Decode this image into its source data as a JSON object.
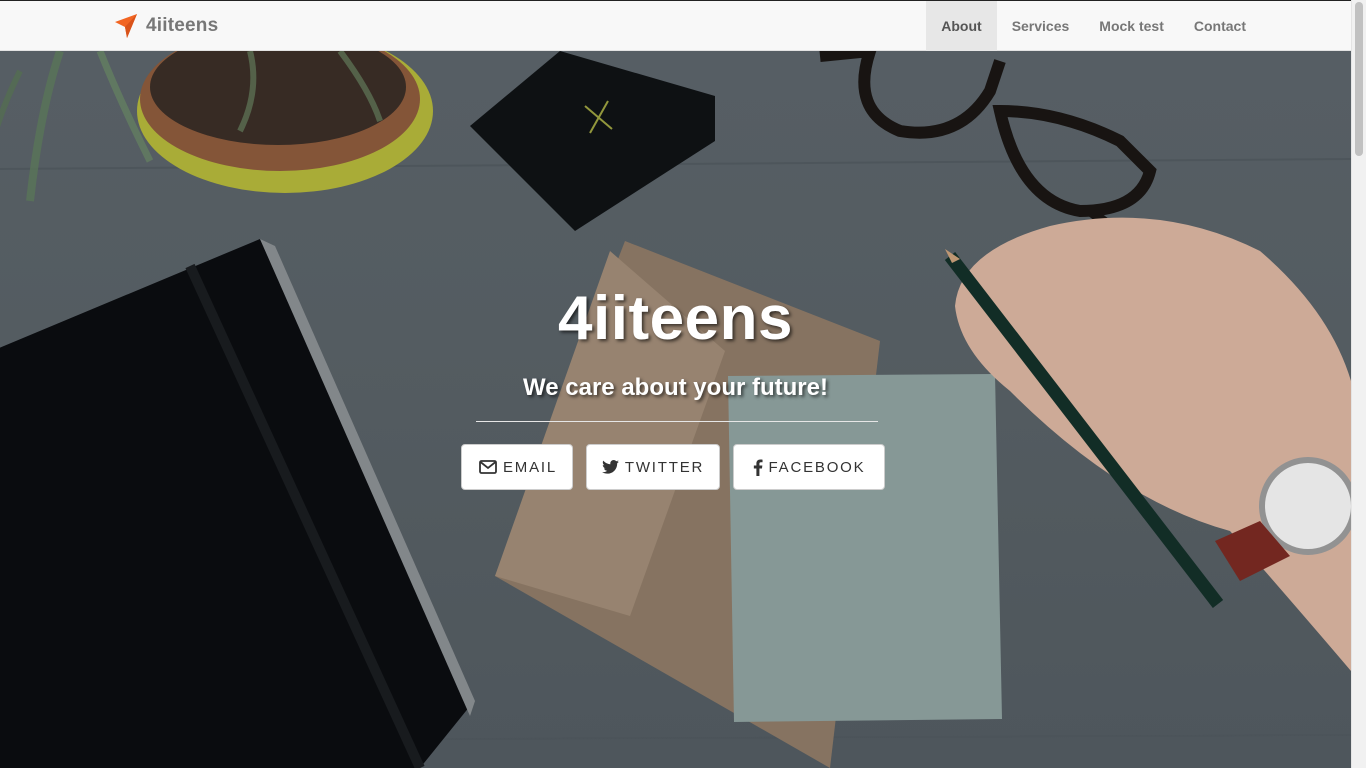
{
  "navbar": {
    "brand_name": "4iiteens",
    "brand_icon": "paper-plane-icon",
    "brand_color": "#f26522",
    "links": [
      {
        "label": "About",
        "active": true
      },
      {
        "label": "Services",
        "active": false
      },
      {
        "label": "Mock test",
        "active": false
      },
      {
        "label": "Contact",
        "active": false
      }
    ]
  },
  "hero": {
    "title": "4iiteens",
    "subtitle": "We care about your future!",
    "buttons": [
      {
        "label": "EMAIL",
        "icon": "envelope-icon"
      },
      {
        "label": "TWITTER",
        "icon": "twitter-icon"
      },
      {
        "label": "FACEBOOK",
        "icon": "facebook-icon"
      }
    ]
  }
}
